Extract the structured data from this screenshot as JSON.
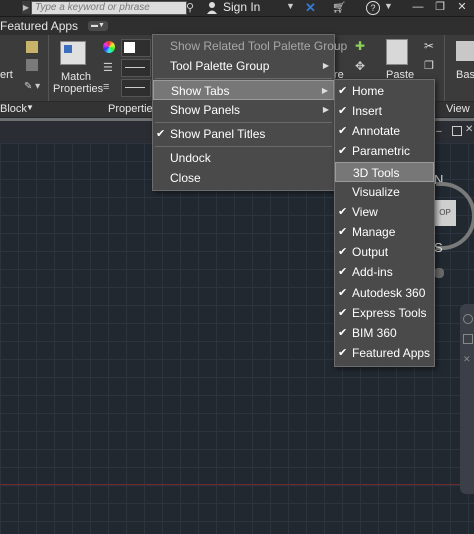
{
  "topbar": {
    "search_placeholder": "Type a keyword or phrase",
    "signin_label": "Sign In",
    "help_icon": "?",
    "icons": [
      "search-arrow",
      "binoculars-icon",
      "user-icon",
      "exchange-x-icon",
      "cart-icon",
      "help-icon"
    ]
  },
  "tabrow": {
    "active_tab": "Featured Apps"
  },
  "ribbon": {
    "left_labels": [
      "ert",
      "Block"
    ],
    "match_properties": [
      "Match",
      "Properties"
    ],
    "properties_panel": "Properties",
    "right_labels": {
      "re": "re",
      "paste": "Paste",
      "bas": "Bas",
      "view": "View"
    }
  },
  "menu_main": {
    "items": [
      {
        "label": "Show Related Tool Palette Group",
        "disabled": true
      },
      {
        "label": "Tool Palette Group",
        "submenu": true
      },
      {
        "label": "Show Tabs",
        "submenu": true,
        "highlighted": true
      },
      {
        "label": "Show Panels",
        "submenu": true
      },
      {
        "label": "Show Panel Titles",
        "checked": true
      },
      {
        "label": "Undock"
      },
      {
        "label": "Close"
      }
    ]
  },
  "menu_tabs": {
    "items": [
      {
        "label": "Home",
        "checked": true
      },
      {
        "label": "Insert",
        "checked": true
      },
      {
        "label": "Annotate",
        "checked": true
      },
      {
        "label": "Parametric",
        "checked": true
      },
      {
        "label": "3D Tools",
        "checked": false,
        "hover": true
      },
      {
        "label": "Visualize",
        "checked": false
      },
      {
        "label": "View",
        "checked": true
      },
      {
        "label": "Manage",
        "checked": true
      },
      {
        "label": "Output",
        "checked": true
      },
      {
        "label": "Add-ins",
        "checked": true
      },
      {
        "label": "Autodesk 360",
        "checked": true
      },
      {
        "label": "Express Tools",
        "checked": true
      },
      {
        "label": "BIM 360",
        "checked": true
      },
      {
        "label": "Featured Apps",
        "checked": true
      }
    ]
  },
  "viewcube": {
    "n": "N",
    "s": "S",
    "face": "OP"
  },
  "colors": {
    "canvas": "#212830",
    "menu_bg": "#4a4a4a",
    "highlight": "#777777",
    "accent_blue": "#2f7bd6"
  }
}
